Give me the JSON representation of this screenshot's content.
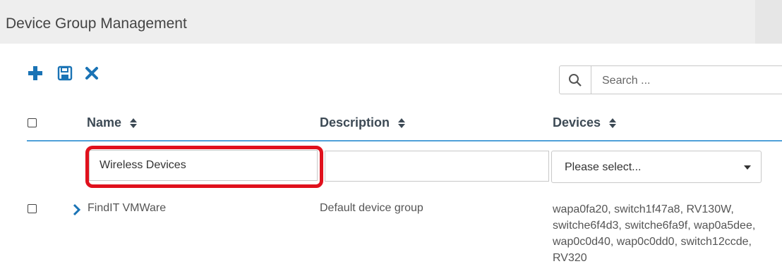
{
  "page": {
    "title": "Device Group Management"
  },
  "toolbar": {
    "add_icon": "plus-icon",
    "save_icon": "save-icon",
    "delete_icon": "close-icon",
    "accent_color": "#1a73b5"
  },
  "search": {
    "icon": "search-icon",
    "placeholder": "Search ..."
  },
  "table": {
    "columns": [
      {
        "label": "Name",
        "sortable": true
      },
      {
        "label": "Description",
        "sortable": true
      },
      {
        "label": "Devices",
        "sortable": true
      }
    ],
    "header_line_color": "#4fa0d8",
    "new_row": {
      "name_value": "Wireless Devices",
      "description_value": "",
      "devices_select_value": "Please select...",
      "highlight_color": "#e0111d"
    },
    "rows": [
      {
        "expand_icon": "chevron-right-icon",
        "name": "FindIT VMWare",
        "description": "Default device group",
        "devices": "wapa0fa20, switch1f47a8, RV130W, switche6f4d3, switche6fa9f, wap0a5dee, wap0c0d40, wap0c0dd0, switch12ccde, RV320"
      }
    ]
  }
}
